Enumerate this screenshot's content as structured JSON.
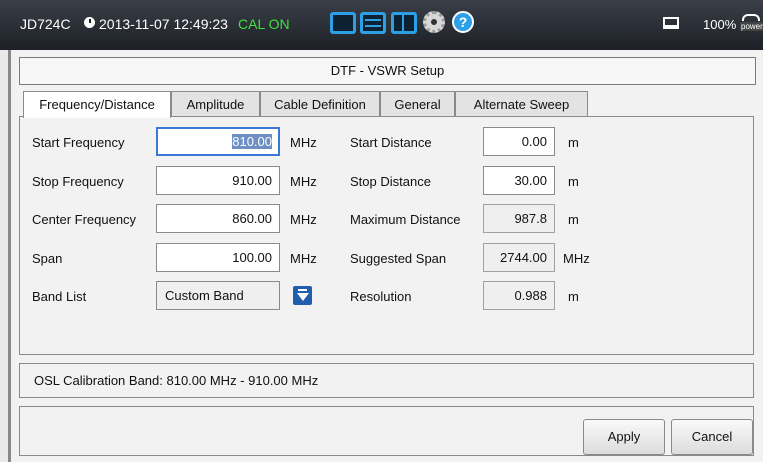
{
  "statusbar": {
    "device": "JD724C",
    "datetime": "2013-11-07 12:49:23",
    "cal_status": "CAL ON",
    "battery": "100%",
    "power_label": "power",
    "icons": [
      "clock-icon",
      "single-view-icon",
      "dual-view-icon",
      "split-view-icon",
      "settings-gear-icon",
      "help-icon",
      "laptop-icon",
      "power-plug-icon"
    ]
  },
  "dialog": {
    "title": "DTF - VSWR Setup",
    "tabs": [
      "Frequency/Distance",
      "Amplitude",
      "Cable Definition",
      "General",
      "Alternate Sweep"
    ],
    "active_tab": "Frequency/Distance",
    "left": {
      "start_freq": {
        "label": "Start Frequency",
        "value": "810.00",
        "unit": "MHz"
      },
      "stop_freq": {
        "label": "Stop Frequency",
        "value": "910.00",
        "unit": "MHz"
      },
      "center_freq": {
        "label": "Center Frequency",
        "value": "860.00",
        "unit": "MHz"
      },
      "span": {
        "label": "Span",
        "value": "100.00",
        "unit": "MHz"
      },
      "band_list": {
        "label": "Band List",
        "value": "Custom Band"
      }
    },
    "right": {
      "start_dist": {
        "label": "Start Distance",
        "value": "0.00",
        "unit": "m"
      },
      "stop_dist": {
        "label": "Stop Distance",
        "value": "30.00",
        "unit": "m"
      },
      "max_dist": {
        "label": "Maximum Distance",
        "value": "987.8",
        "unit": "m"
      },
      "suggested_span": {
        "label": "Suggested Span",
        "value": "2744.00",
        "unit": "MHz"
      },
      "resolution": {
        "label": "Resolution",
        "value": "0.988",
        "unit": "m"
      }
    },
    "osl_info": "OSL Calibration Band: 810.00 MHz - 910.00 MHz",
    "buttons": {
      "apply": "Apply",
      "cancel": "Cancel"
    }
  },
  "colors": {
    "accent": "#2c9fe6",
    "cal_on": "#3fe03f",
    "selection": "#3b78d8"
  }
}
